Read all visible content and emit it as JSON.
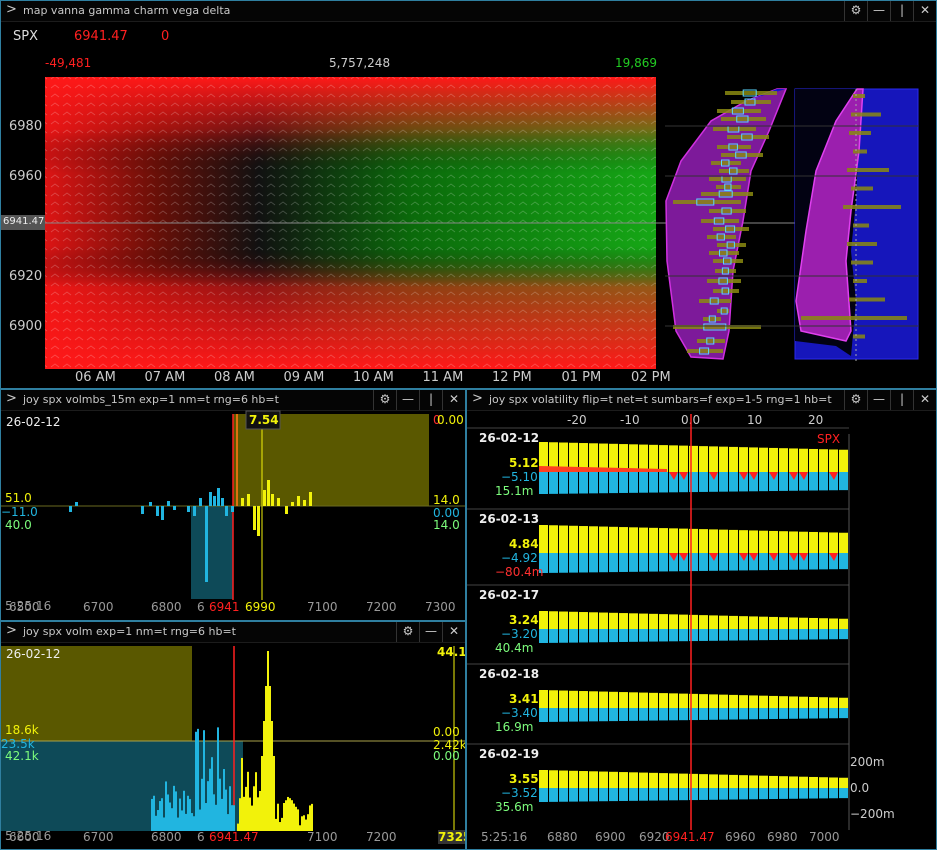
{
  "colors": {
    "red": "#ff2020",
    "green": "#22dd22",
    "yellow": "#f2f20a",
    "cyan": "#21b5e0",
    "lightgreen": "#7cfc7c",
    "olive": "#5a5800",
    "teal": "#0e4a58",
    "border": "#2f7fa0",
    "magenta": "#d020d0",
    "blue": "#1515c8"
  },
  "icons": {
    "expand": "chevron-right-icon",
    "settings": "gear-icon",
    "minimize": "minimize-icon",
    "split": "split-icon",
    "close": "close-icon"
  },
  "window_buttons": {
    "settings": "⚙",
    "minimize": "—",
    "split": "|",
    "close": "✕"
  },
  "map_panel": {
    "title": "map vanna gamma charm vega delta",
    "symbol": "SPX",
    "price": "6941.47",
    "change": "0",
    "scale_min": "-49,481",
    "scale_mid": "5,757,248",
    "scale_max": "19,869",
    "price_tag": "6941.47",
    "y_ticks": [
      "6980",
      "6960",
      "6920",
      "6900"
    ],
    "x_ticks": [
      "06 AM",
      "07 AM",
      "08 AM",
      "09 AM",
      "10 AM",
      "11 AM",
      "12 PM",
      "01 PM",
      "02 PM"
    ]
  },
  "volmbs_panel": {
    "title": "joy spx volmbs_15m exp=1 nm=t rng=6 hb=t",
    "date": "26-02-12",
    "cursor_value": "7.54",
    "top_right_red": "0",
    "top_right_yellow": "0.00",
    "left_values": [
      "51.0",
      "−11.0",
      "40.0"
    ],
    "right_values": [
      "14.0",
      "0.00",
      "14.0"
    ],
    "time": "5:25:16",
    "x_ticks": [
      "6500",
      "6700",
      "6800",
      "6",
      "6900",
      "7000",
      "7100",
      "7200",
      "7300"
    ],
    "spot_label": "6941",
    "cursor_label": "6990"
  },
  "volm_panel": {
    "title": "joy spx volm exp=1 nm=t rng=6 hb=t",
    "date": "26-02-12",
    "top_right": "44.1",
    "left_values": [
      "18.6k",
      "23.5k",
      "42.1k"
    ],
    "right_values": [
      "0.00",
      "2.42k",
      "0.00"
    ],
    "time": "5:25:16",
    "x_ticks": [
      "6600",
      "6700",
      "6800",
      "6",
      "6900",
      "7000",
      "7100",
      "7200",
      "73"
    ],
    "spot_label": "6941.47",
    "edge_label": "7325"
  },
  "flip_panel": {
    "title": "joy spx volatility flip=t net=t sumbars=f exp=1-5 rng=1 hb=t",
    "top_ticks": [
      "-20",
      "-10",
      "0.0",
      "10",
      "20"
    ],
    "spx_label": "SPX",
    "rows": [
      {
        "date": "26-02-12",
        "v1": "5.12",
        "v2": "−5.10",
        "v3": "15.1m",
        "v3color": "#7cfc7c"
      },
      {
        "date": "26-02-13",
        "v1": "4.84",
        "v2": "−4.92",
        "v3": "−80.4m",
        "v3color": "#ff3030"
      },
      {
        "date": "26-02-17",
        "v1": "3.24",
        "v2": "−3.20",
        "v3": "40.4m",
        "v3color": "#7cfc7c"
      },
      {
        "date": "26-02-18",
        "v1": "3.41",
        "v2": "−3.40",
        "v3": "16.9m",
        "v3color": "#7cfc7c"
      },
      {
        "date": "26-02-19",
        "v1": "3.55",
        "v2": "−3.52",
        "v3": "35.6m",
        "v3color": "#7cfc7c"
      }
    ],
    "right_scale": [
      "200m",
      "0.0",
      "−200m"
    ],
    "time": "5:25:16",
    "x_ticks": [
      "6880",
      "6900",
      "6920",
      "6960",
      "6980",
      "7000"
    ],
    "spot_label": "6941.47"
  }
}
